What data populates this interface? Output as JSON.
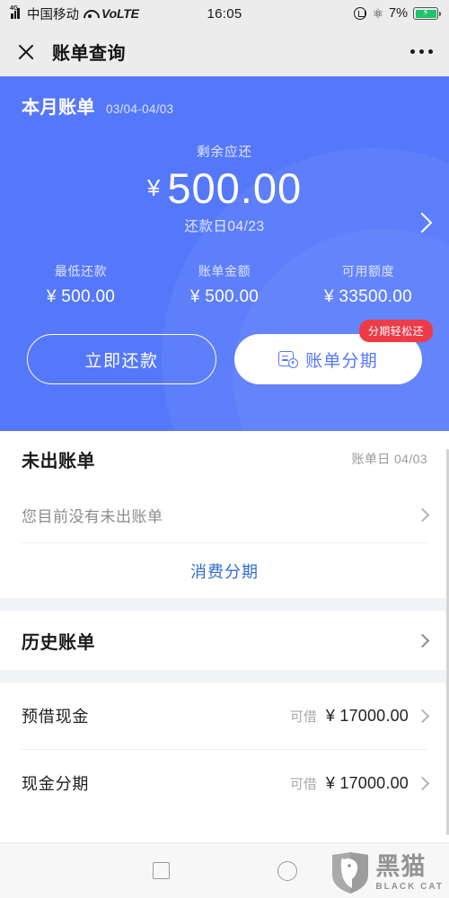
{
  "status_bar": {
    "network_type": "4G",
    "carrier": "中国移动",
    "volte": "VoLTE",
    "time": "16:05",
    "battery_percent": "7%",
    "icons": [
      "signal-icon",
      "wifi-icon",
      "rotation-lock-icon",
      "bluetooth-icon",
      "battery-charging-icon"
    ]
  },
  "header": {
    "close_icon": "close-icon",
    "title": "账单查询",
    "more_icon": "more-options-icon"
  },
  "card": {
    "title": "本月账单",
    "date_range": "03/04-04/03",
    "summary_label": "剩余应还",
    "currency": "¥",
    "amount": "500.00",
    "due_date": "还款日04/23",
    "chevron_icon": "chevron-right-icon",
    "stats": [
      {
        "label": "最低还款",
        "value": "¥ 500.00"
      },
      {
        "label": "账单金额",
        "value": "¥ 500.00"
      },
      {
        "label": "可用额度",
        "value": "¥ 33500.00"
      }
    ],
    "primary_button": "立即还款",
    "secondary_button": "账单分期",
    "secondary_button_icon": "bill-installment-icon",
    "badge": "分期轻松还",
    "colors": {
      "card_blue": "#5578fb",
      "badge_red": "#ee3b48",
      "accent_link": "#2f6fd0"
    }
  },
  "unbilled_section": {
    "title": "未出账单",
    "meta": "账单日 04/03",
    "empty_text": "您目前没有未出账单",
    "chevron_icon": "chevron-right-icon",
    "link": "消费分期"
  },
  "history_section": {
    "title": "历史账单",
    "chevron_icon": "chevron-right-icon"
  },
  "cash_section": {
    "rows": [
      {
        "label": "预借现金",
        "amount_label": "可借",
        "amount": "¥ 17000.00",
        "chevron_icon": "chevron-right-icon"
      },
      {
        "label": "现金分期",
        "amount_label": "可借",
        "amount": "¥ 17000.00",
        "chevron_icon": "chevron-right-icon"
      }
    ]
  },
  "nav_bar": {
    "recents_icon": "square-recents-icon",
    "home_icon": "circle-home-icon"
  },
  "watermark": {
    "name_cn": "黑猫",
    "name_en": "BLACK CAT",
    "logo_icon": "black-cat-shield-logo"
  }
}
